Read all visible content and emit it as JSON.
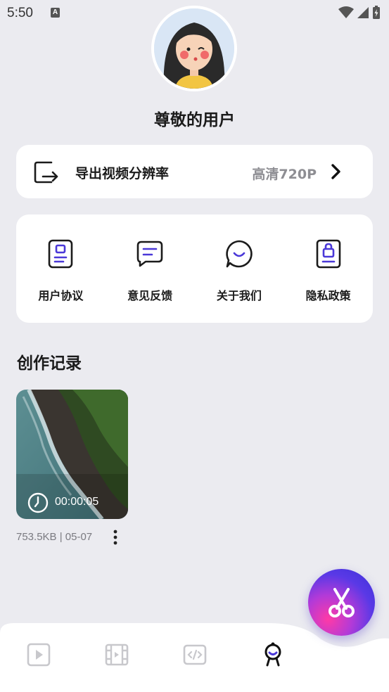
{
  "status_bar": {
    "time": "5:50",
    "indicator": "A"
  },
  "profile": {
    "username": "尊敬的用户"
  },
  "export_setting": {
    "label": "导出视频分辨率",
    "value": "高清720P"
  },
  "menu": [
    {
      "label": "用户协议",
      "icon": "user-agreement-icon"
    },
    {
      "label": "意见反馈",
      "icon": "feedback-icon"
    },
    {
      "label": "关于我们",
      "icon": "about-us-icon"
    },
    {
      "label": "隐私政策",
      "icon": "privacy-policy-icon"
    }
  ],
  "records_section": {
    "title": "创作记录",
    "items": [
      {
        "duration": "00:00:05",
        "meta": "753.5KB | 05-07"
      }
    ]
  },
  "fab": {
    "icon": "scissors-icon"
  },
  "bottom_nav": [
    {
      "icon": "play-icon",
      "active": false
    },
    {
      "icon": "film-icon",
      "active": false
    },
    {
      "icon": "code-icon",
      "active": false
    },
    {
      "icon": "profile-icon",
      "active": true
    }
  ],
  "colors": {
    "background": "#ebebf0",
    "accent": "#4a38d8",
    "secondary_text": "#8e8e93"
  }
}
